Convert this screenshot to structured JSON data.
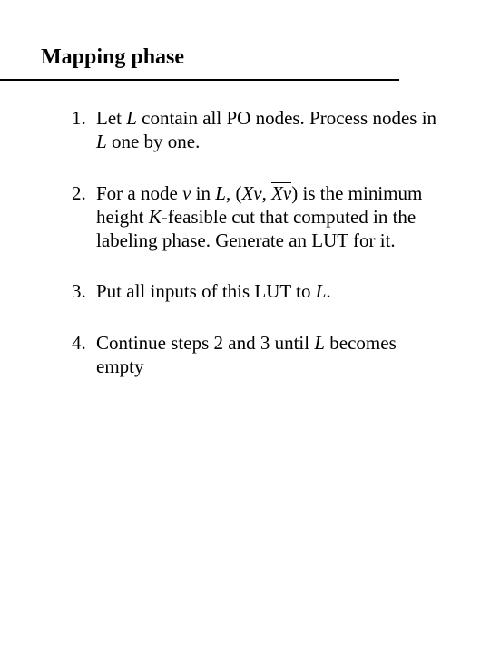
{
  "title": "Mapping phase",
  "steps": {
    "s1a": "Let ",
    "s1b": " contain all PO nodes. Process nodes in ",
    "s1c": " one by one.",
    "s2a": "For a node ",
    "s2b": " in ",
    "s2c": ", ",
    "s2d": " is the minimum height ",
    "s2e": "-feasible cut that computed in the labeling phase. Generate an LUT for it.",
    "s3a": "Put all inputs of this LUT to ",
    "s3b": ".",
    "s4a": "Continue steps 2 and 3 until ",
    "s4b": " becomes empty"
  },
  "sym": {
    "L": "L",
    "v": "v",
    "K": "K",
    "lpar": "(",
    "rpar": ")",
    "comma": ", ",
    "Xv": "Xv",
    "Xvbar": "Xv"
  }
}
